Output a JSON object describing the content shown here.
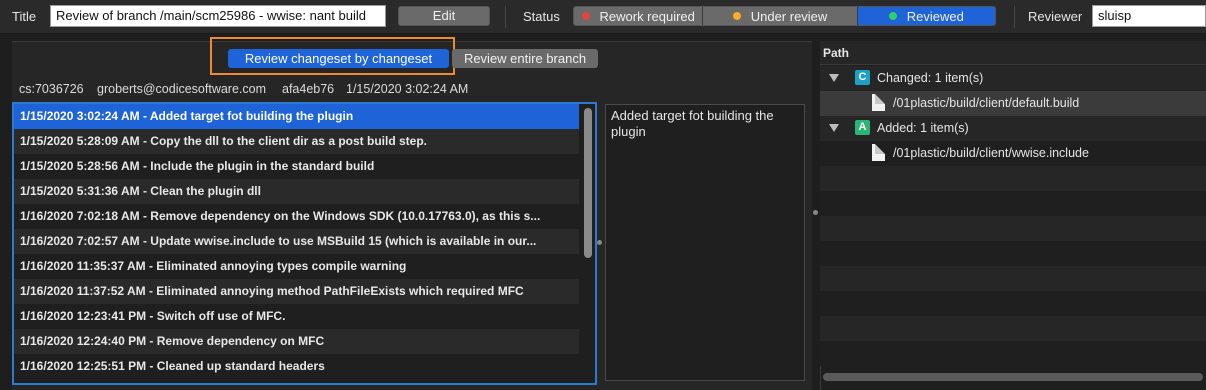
{
  "header": {
    "title_label": "Title",
    "title_value": "Review of branch /main/scm25986 - wwise: nant build",
    "edit_label": "Edit",
    "status_label": "Status",
    "status_options": [
      {
        "label": "Rework required",
        "color": "#e0443a",
        "active": false
      },
      {
        "label": "Under review",
        "color": "#f2b02a",
        "active": false
      },
      {
        "label": "Reviewed",
        "color": "#2ecf6a",
        "active": true
      }
    ],
    "reviewer_label": "Reviewer",
    "reviewer_value": "sluisp"
  },
  "mode": {
    "by_changeset_label": "Review changeset by changeset",
    "entire_branch_label": "Review entire branch"
  },
  "changeset": {
    "id": "cs:7036726",
    "author": "groberts@codicesoftware.com",
    "hash": "afa4eb76",
    "date": "1/15/2020 3:02:24 AM"
  },
  "changesets": [
    {
      "text": "1/15/2020 3:02:24 AM - Added target fot building the plugin",
      "selected": true
    },
    {
      "text": "1/15/2020 5:28:09 AM - Copy the dll to the client dir as a post build step."
    },
    {
      "text": "1/15/2020 5:28:56 AM - Include the plugin in the standard build"
    },
    {
      "text": "1/15/2020 5:31:36 AM - Clean the plugin dll"
    },
    {
      "text": "1/16/2020 7:02:18 AM - Remove dependency on the Windows SDK (10.0.17763.0), as this s..."
    },
    {
      "text": "1/16/2020 7:02:57 AM - Update wwise.include to use MSBuild 15 (which is available in our..."
    },
    {
      "text": "1/16/2020 11:35:37 AM - Eliminated annoying types compile warning"
    },
    {
      "text": "1/16/2020 11:37:52 AM - Eliminated annoying method PathFileExists which required MFC"
    },
    {
      "text": "1/16/2020 12:23:41 PM - Switch off use of MFC."
    },
    {
      "text": "1/16/2020 12:24:40 PM - Remove dependency on MFC"
    },
    {
      "text": "1/16/2020 12:25:51 PM - Cleaned up standard headers"
    }
  ],
  "comment": "Added target fot building the plugin",
  "tree": {
    "header": "Path",
    "groups": [
      {
        "badge": "C",
        "badge_color": "#1ba3c6",
        "label": "Changed: 1 item(s)",
        "file": "/01plastic/build/client/default.build"
      },
      {
        "badge": "A",
        "badge_color": "#2bb673",
        "label": "Added: 1 item(s)",
        "file": "/01plastic/build/client/wwise.include"
      }
    ]
  }
}
